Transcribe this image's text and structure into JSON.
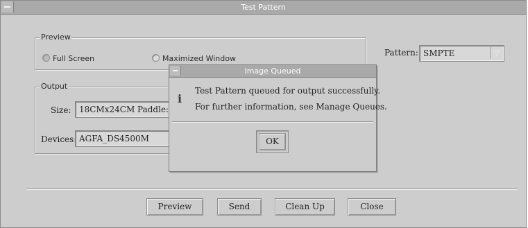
{
  "window": {
    "title": "Test Pattern"
  },
  "preview_group": {
    "legend": "Preview",
    "options": [
      {
        "label": "Full Screen",
        "selected": true
      },
      {
        "label": "Maximized Window",
        "selected": false
      }
    ]
  },
  "pattern": {
    "label": "Pattern:",
    "value": "SMPTE"
  },
  "output_group": {
    "legend": "Output",
    "size_label": "Size:",
    "size_value": "18CMx24CM Paddle:",
    "devices_label": "Devices:",
    "devices_value": "AGFA_DS4500M"
  },
  "buttons": {
    "preview": "Preview",
    "send": "Send",
    "clean_up": "Clean Up",
    "close": "Close"
  },
  "dialog": {
    "title": "Image Queued",
    "icon": "info-icon",
    "line1": "Test Pattern queued for output successfully.",
    "line2": "For further information, see Manage Queues.",
    "ok": "OK"
  }
}
